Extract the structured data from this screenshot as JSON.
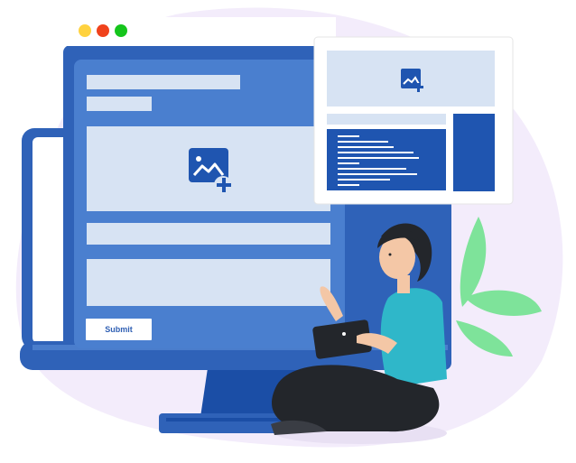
{
  "form": {
    "submit_label": "Submit"
  },
  "colors": {
    "blob": "#f3ecfb",
    "monitor_blue": "#2f62b8",
    "form_blue": "#4a7fcf",
    "field_fill": "#d7e3f3",
    "dark_blue": "#1f55b0",
    "stand": "#1b4ea6",
    "traffic_red": "#f0421c",
    "traffic_yellow": "#ffd23f",
    "traffic_green": "#15c51c",
    "shirt": "#2fb7c9",
    "pants": "#23262b",
    "leaf": "#7ee39a"
  },
  "icons": [
    "add-image-icon",
    "add-image-icon-small"
  ]
}
